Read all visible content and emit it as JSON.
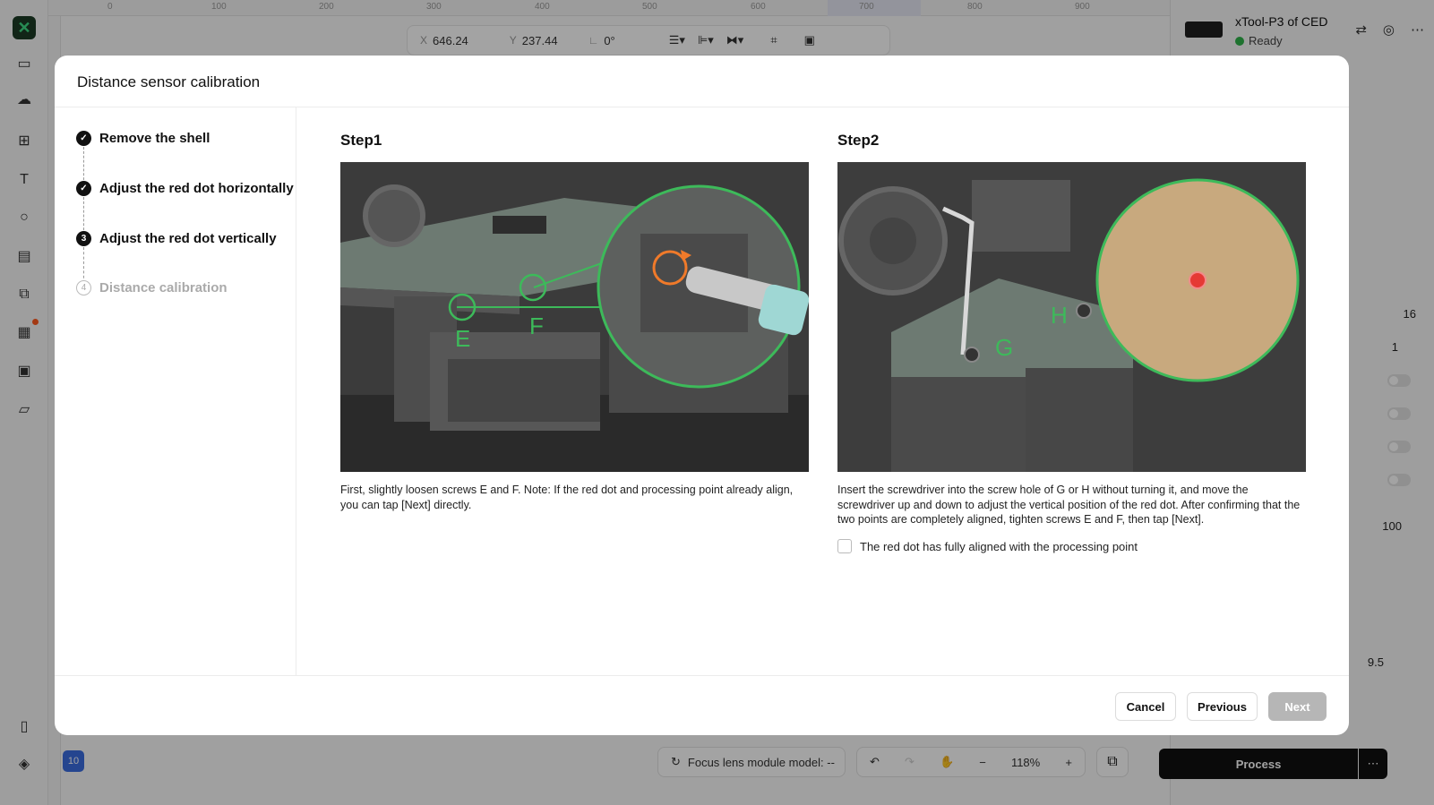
{
  "background": {
    "toolbar": {
      "x_label": "X",
      "x_value": "646.24",
      "y_label": "Y",
      "y_value": "237.44",
      "angle_value": "0°"
    },
    "ruler_ticks": [
      "0",
      "100",
      "200",
      "300",
      "400",
      "500",
      "600",
      "700",
      "800",
      "900"
    ],
    "device": {
      "name": "xTool-P3 of CED",
      "status": "Ready"
    },
    "right_values": [
      "16",
      "1",
      "100",
      "9.5"
    ],
    "focus_module": "Focus lens module model: --",
    "zoom": "118%",
    "layer_badge": "10",
    "process_label": "Process"
  },
  "modal": {
    "title": "Distance sensor calibration",
    "steps": [
      {
        "label": "Remove the shell",
        "state": "done"
      },
      {
        "label": "Adjust the red dot horizontally",
        "state": "done"
      },
      {
        "label": "Adjust the red dot vertically",
        "state": "current",
        "number": "3"
      },
      {
        "label": "Distance calibration",
        "state": "future",
        "number": "4"
      }
    ],
    "step1": {
      "title": "Step1",
      "text": "First, slightly loosen screws E and F. Note: If the red dot and processing point already align, you can tap [Next] directly.",
      "labels": [
        "E",
        "F"
      ]
    },
    "step2": {
      "title": "Step2",
      "text": "Insert the screwdriver into the screw hole of G or H without turning it, and move the screwdriver up and down to adjust the vertical position of the red dot. After confirming that the two points are completely aligned, tighten screws E and F, then tap [Next].",
      "labels": [
        "G",
        "H"
      ],
      "checkbox_label": "The red dot has fully aligned with the processing point"
    },
    "buttons": {
      "cancel": "Cancel",
      "previous": "Previous",
      "next": "Next"
    }
  },
  "colors": {
    "accent_green": "#3dba5a",
    "orange": "#f07a2a",
    "red_dot": "#e53935",
    "disabled": "#b6b6b6"
  }
}
